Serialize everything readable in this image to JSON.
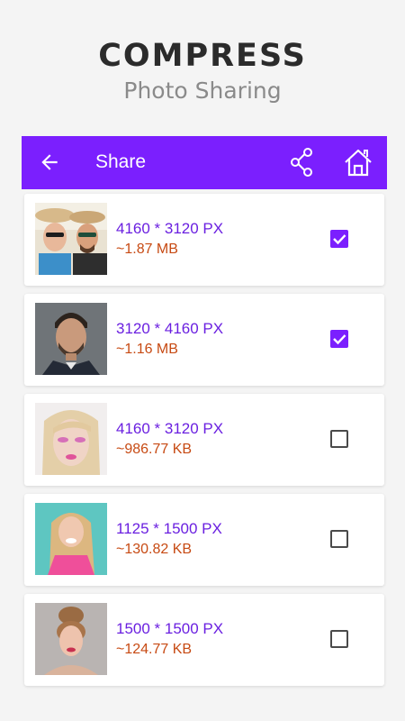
{
  "hero": {
    "title": "COMPRESS",
    "subtitle": "Photo Sharing"
  },
  "app_bar": {
    "title": "Share",
    "back_icon": "arrow-left-icon",
    "share_icon": "share-icon",
    "home_icon": "home-icon",
    "color": "#7b1ffe"
  },
  "items": [
    {
      "dimensions": "4160 * 3120 PX",
      "size": "~1.87 MB",
      "checked": true,
      "thumb": "couple-hats-photo"
    },
    {
      "dimensions": "3120 * 4160 PX",
      "size": "~1.16 MB",
      "checked": true,
      "thumb": "man-portrait-photo"
    },
    {
      "dimensions": "4160 * 3120 PX",
      "size": "~986.77 KB",
      "checked": false,
      "thumb": "woman-makeup-photo"
    },
    {
      "dimensions": "1125 * 1500 PX",
      "size": "~130.82 KB",
      "checked": false,
      "thumb": "woman-pink-top-photo"
    },
    {
      "dimensions": "1500 * 1500 PX",
      "size": "~124.77 KB",
      "checked": false,
      "thumb": "woman-updo-photo"
    }
  ],
  "colors": {
    "dimensions_text": "#6a1fe0",
    "size_text": "#c74a13",
    "checkbox_on": "#7b1ffe"
  }
}
